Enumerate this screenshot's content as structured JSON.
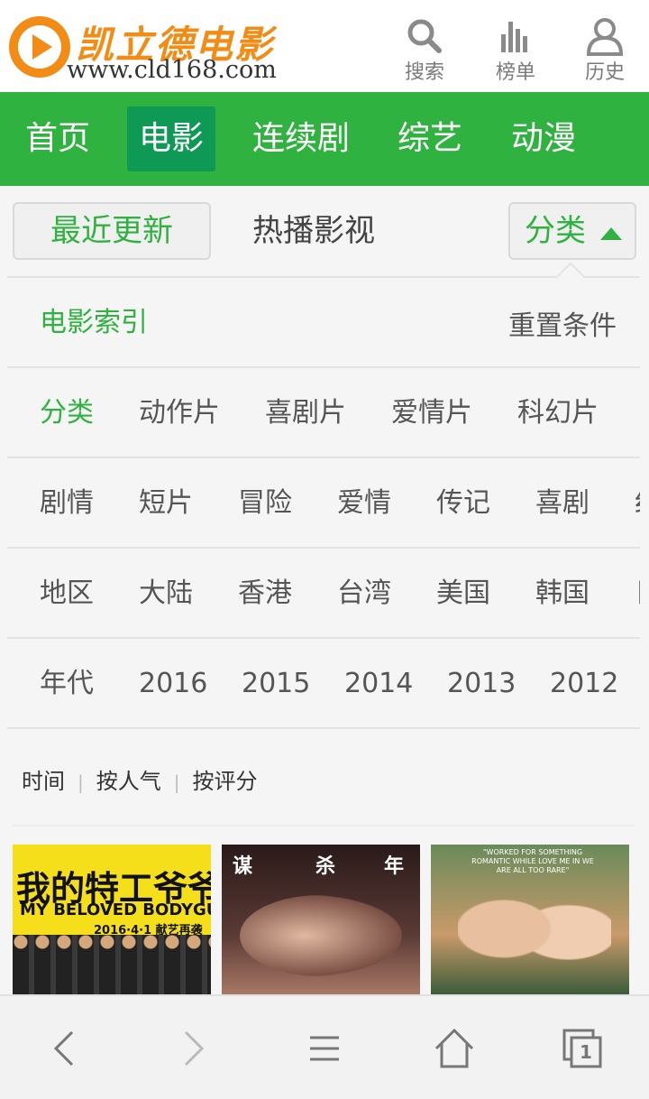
{
  "header": {
    "logo_text": "凯立德电影",
    "logo_url": "www.cld168.com",
    "actions": [
      {
        "label": "搜索",
        "icon": "search-icon"
      },
      {
        "label": "榜单",
        "icon": "chart-bars-icon"
      },
      {
        "label": "历史",
        "icon": "user-icon"
      }
    ]
  },
  "nav": {
    "items": [
      "首页",
      "电影",
      "连续剧",
      "综艺",
      "动漫"
    ],
    "active": "电影"
  },
  "tabs": {
    "recent": "最近更新",
    "hot": "热播影视",
    "category": "分类"
  },
  "filter": {
    "index_label": "电影索引",
    "reset_label": "重置条件",
    "rows": [
      {
        "label": "分类",
        "options": [
          "动作片",
          "喜剧片",
          "爱情片",
          "科幻片"
        ]
      },
      {
        "label": "剧情",
        "options": [
          "短片",
          "冒险",
          "爱情",
          "传记",
          "喜剧",
          "纪"
        ]
      },
      {
        "label": "地区",
        "options": [
          "大陆",
          "香港",
          "台湾",
          "美国",
          "韩国",
          "日"
        ]
      },
      {
        "label": "年代",
        "options": [
          "2016",
          "2015",
          "2014",
          "2013",
          "2012"
        ]
      }
    ]
  },
  "sort": {
    "options": [
      "时间",
      "按人气",
      "按评分"
    ],
    "separator": "|"
  },
  "posters": [
    {
      "big_title": "我的特工爷爷",
      "english_title": "MY BELOVED BODYGUARD",
      "date": "2016·4·1 献艺再袭"
    },
    {
      "chars": [
        "谋",
        "杀",
        "年"
      ]
    },
    {
      "tagline": "\"WORKED FOR SOMETHING ROMANTIC WHILE LOVE ME IN WE ARE ALL TOO RARE\""
    }
  ],
  "bottom_bar": {
    "tab_count": "1"
  },
  "colors": {
    "brand_green": "#2fb23f",
    "active_nav": "#0e9a55",
    "logo_orange": "#f28c14"
  }
}
